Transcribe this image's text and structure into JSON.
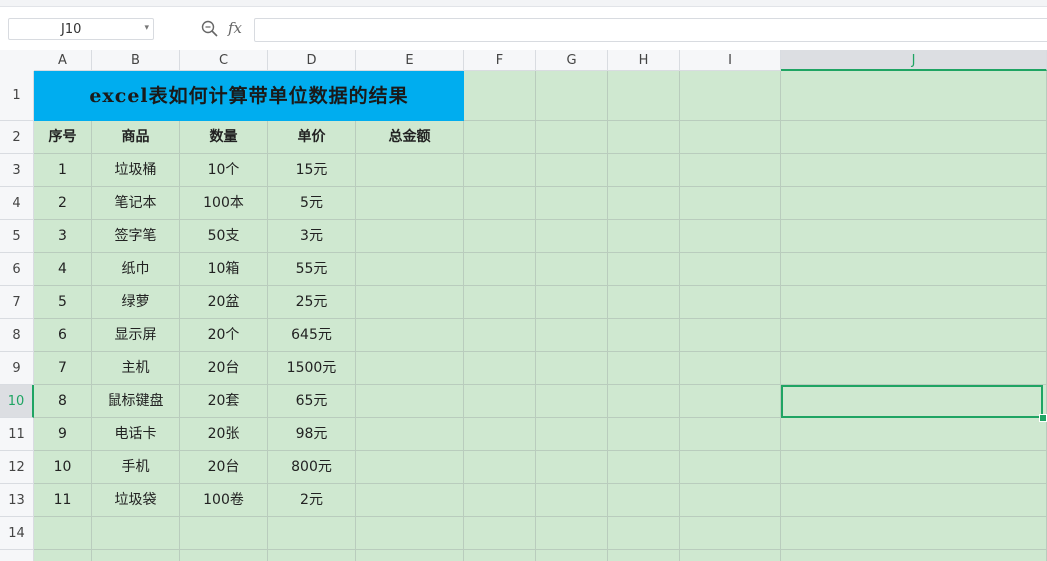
{
  "formula_bar": {
    "name_box": "J10",
    "fx_label": "fx",
    "formula_value": ""
  },
  "colors": {
    "title_bg": "#00adef",
    "grid_bg": "#cfe8d0",
    "selection": "#1fa463"
  },
  "columns": [
    "A",
    "B",
    "C",
    "D",
    "E",
    "F",
    "G",
    "H",
    "I",
    "J"
  ],
  "rows": [
    "1",
    "2",
    "3",
    "4",
    "5",
    "6",
    "7",
    "8",
    "9",
    "10",
    "11",
    "12",
    "13",
    "14"
  ],
  "active_column": "J",
  "active_row": "10",
  "sheet": {
    "title": "excel表如何计算带单位数据的结果",
    "headers": [
      "序号",
      "商品",
      "数量",
      "单价",
      "总金额"
    ],
    "data": [
      [
        "1",
        "垃圾桶",
        "10个",
        "15元",
        ""
      ],
      [
        "2",
        "笔记本",
        "100本",
        "5元",
        ""
      ],
      [
        "3",
        "签字笔",
        "50支",
        "3元",
        ""
      ],
      [
        "4",
        "纸巾",
        "10箱",
        "55元",
        ""
      ],
      [
        "5",
        "绿萝",
        "20盆",
        "25元",
        ""
      ],
      [
        "6",
        "显示屏",
        "20个",
        "645元",
        ""
      ],
      [
        "7",
        "主机",
        "20台",
        "1500元",
        ""
      ],
      [
        "8",
        "鼠标键盘",
        "20套",
        "65元",
        ""
      ],
      [
        "9",
        "电话卡",
        "20张",
        "98元",
        ""
      ],
      [
        "10",
        "手机",
        "20台",
        "800元",
        ""
      ],
      [
        "11",
        "垃圾袋",
        "100卷",
        "2元",
        ""
      ]
    ]
  }
}
